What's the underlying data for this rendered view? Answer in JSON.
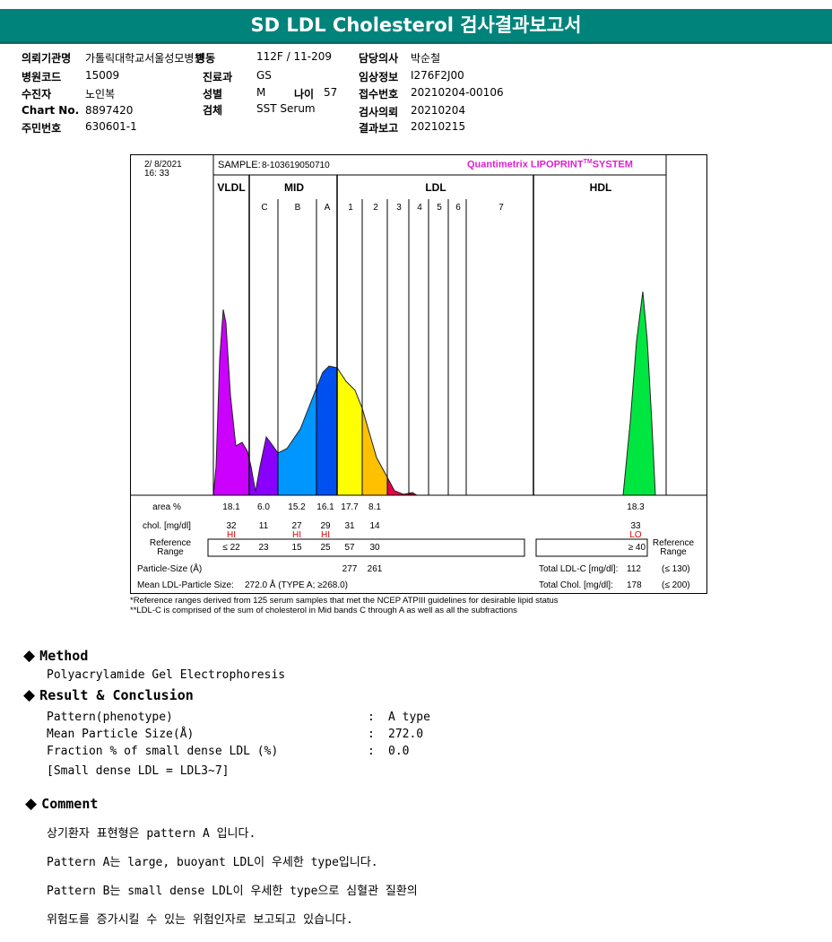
{
  "title": "SD LDL Cholesterol 검사결과보고서",
  "info": {
    "inst_label": "의뢰기관명",
    "inst": "가톨릭대학교서울성모병원",
    "ward_label": "병동",
    "ward": "112F / 11-209",
    "doctor_label": "담당의사",
    "doctor": "박순철",
    "code_label": "병원코드",
    "code": "15009",
    "dept_label": "진료과",
    "dept": "GS",
    "clin_label": "임상정보",
    "clin": "I276F2J00",
    "patient_label": "수진자",
    "patient": "노인복",
    "sex_label": "성별",
    "sex": "M",
    "age_label": "나이",
    "age": "57",
    "recv_label": "접수번호",
    "recv": "20210204-00106",
    "chart_label": "Chart No.",
    "chart": "8897420",
    "spec_label": "검체",
    "spec": "SST Serum",
    "req_label": "검사의뢰",
    "req": "20210204",
    "id_label": "주민번호",
    "id": "630601-1",
    "rep_label": "결과보고",
    "rep": "20210215"
  },
  "chart_data": {
    "type": "area",
    "date": "2/ 8/2021",
    "time": "16: 33",
    "sample_label": "SAMPLE:",
    "sample": "8-103619050710",
    "brand": "Quantimetrix LIPOPRINT",
    "brand_tm": "TM",
    "brand_tail": "SYSTEM",
    "sections": [
      "VLDL",
      "MID",
      "LDL",
      "HDL"
    ],
    "bands": [
      "C",
      "B",
      "A",
      "1",
      "2",
      "3",
      "4",
      "5",
      "6",
      "7"
    ],
    "row_labels": {
      "area": "area %",
      "chol": "chol. [mg/dl]",
      "ref": "Reference Range",
      "size": "Particle-Size (Å)",
      "mean": "Mean LDL-Particle Size:"
    },
    "area": [
      "18.1",
      "6.0",
      "15.2",
      "16.1",
      "17.7",
      "8.1"
    ],
    "hdl_area": "18.3",
    "chol": [
      "32",
      "11",
      "27",
      "29",
      "31",
      "14"
    ],
    "hdl_chol": "33",
    "flags": [
      "HI",
      "",
      "HI",
      "HI",
      "",
      ""
    ],
    "hdl_flag": "LO",
    "ref": [
      "≤ 22",
      "23",
      "15",
      "25",
      "57",
      "30"
    ],
    "hdl_ref": "≥ 40",
    "size": [
      "277",
      "261"
    ],
    "mean": "272.0 Å  (TYPE A; ≥268.0)",
    "total_ldl_label": "Total LDL-C [mg/dl]:",
    "total_ldl": "112",
    "total_ldl_ref": "(≤ 130)",
    "total_chol_label": "Total Chol. [mg/dl]:",
    "total_chol": "178",
    "total_chol_ref": "(≤ 200)",
    "colors": [
      "#cc00ff",
      "#8a00ff",
      "#0096ff",
      "#0050f0",
      "#ffff00",
      "#ffc000",
      "#e8004a",
      "#00e640"
    ]
  },
  "notes": [
    "*Reference ranges derived from 125 serum samples that met the NCEP ATPIII guidelines for desirable lipid status",
    "**LDL-C is comprised of the sum of cholesterol in Mid bands C through A as well as all the subfractions"
  ],
  "method": {
    "title": "Method",
    "text": "Polyacrylamide Gel Electrophoresis"
  },
  "result": {
    "title": "Result & Conclusion",
    "rows": [
      [
        "Pattern(phenotype)",
        ":",
        "A type"
      ],
      [
        "Mean Particle Size(Å)",
        ":",
        "272.0"
      ],
      [
        "Fraction % of small dense LDL (%)",
        ":",
        "0.0"
      ]
    ],
    "note": "[Small dense LDL = LDL3~7]"
  },
  "comment": {
    "title": "Comment",
    "lines": [
      "상기환자 표현형은 pattern A 입니다.",
      "Pattern A는 large, buoyant LDL이 우세한 type입니다.",
      "Pattern B는 small dense LDL이 우세한 type으로 심혈관 질환의",
      "위험도를 증가시킬 수 있는 위험인자로 보고되고 있습니다."
    ]
  }
}
